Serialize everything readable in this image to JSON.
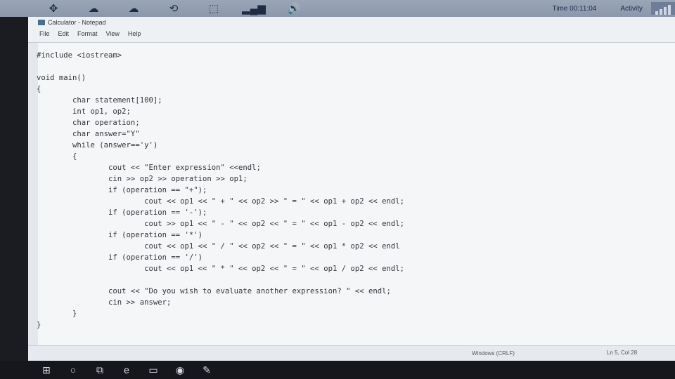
{
  "taskbar_top": {
    "icons": [
      "collapse-icon",
      "cloud-sync-icon",
      "cloud-sync-icon",
      "refresh-icon",
      "share-icon",
      "signal-icon",
      "volume-icon"
    ],
    "time": "Time 00:11:04",
    "activity": "Activity"
  },
  "window": {
    "title": "Calculator - Notepad",
    "menu": [
      "File",
      "Edit",
      "Format",
      "View",
      "Help"
    ],
    "code": "#include <iostream>\n\nvoid main()\n{\n        char statement[100];\n        int op1, op2;\n        char operation;\n        char answer=\"Y\"\n        while (answer=='y')\n        {\n                cout << \"Enter expression\" <<endl;\n                cin >> op2 >> operation >> op1;\n                if (operation == \"+\");\n                        cout << op1 << \" + \" << op2 >> \" = \" << op1 + op2 << endl;\n                if (operation == '-');\n                        cout >> op1 << \" - \" << op2 << \" = \" << op1 - op2 << endl;\n                if (operation == '*')\n                        cout << op1 << \" / \" << op2 << \" = \" << op1 * op2 << endl\n                if (operation == '/')\n                        cout << op1 << \" * \" << op2 << \" = \" << op1 / op2 << endl;\n\n                cout << \"Do you wish to evaluate another expression? \" << endl;\n                cin >> answer;\n        }\n}",
    "status_encoding": "Windows (CRLF)",
    "status_position": "Ln 5, Col 28"
  },
  "taskbar_bottom": {
    "icons": [
      "windows-start-icon",
      "search-icon",
      "task-view-icon",
      "edge-icon",
      "file-explorer-icon",
      "media-icon",
      "notepad-icon"
    ]
  }
}
